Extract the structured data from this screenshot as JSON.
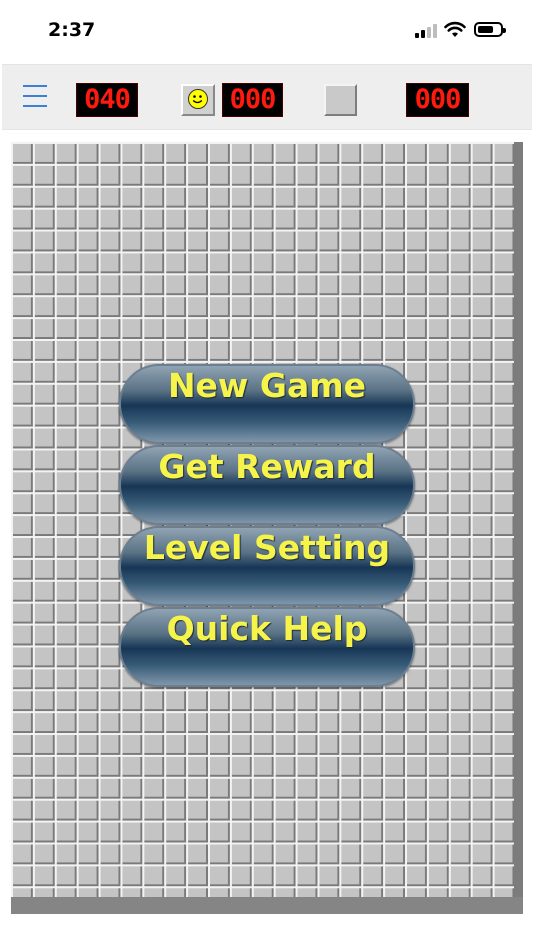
{
  "status_bar": {
    "time": "2:37",
    "icons": [
      "cellular-signal-icon",
      "wifi-icon",
      "battery-icon"
    ]
  },
  "toolbar": {
    "menu_icon": "hamburger-menu-icon",
    "mine_counter": "040",
    "smiley_icon": "smiley-face-icon",
    "score_counter": "000",
    "flag_toggle_icon": "blank-square-icon",
    "timer": "000"
  },
  "board": {
    "cell_state": "unrevealed"
  },
  "menu": {
    "items": [
      {
        "label": "New Game"
      },
      {
        "label": "Get Reward"
      },
      {
        "label": "Level Setting"
      },
      {
        "label": "Quick Help"
      }
    ]
  },
  "colors": {
    "lcd_digit": "#ff1a10",
    "menu_text": "#f6f34a",
    "menu_button_dark": "#173656",
    "menu_icon": "#3b7fd8",
    "cell_face": "#c4c4c4"
  }
}
